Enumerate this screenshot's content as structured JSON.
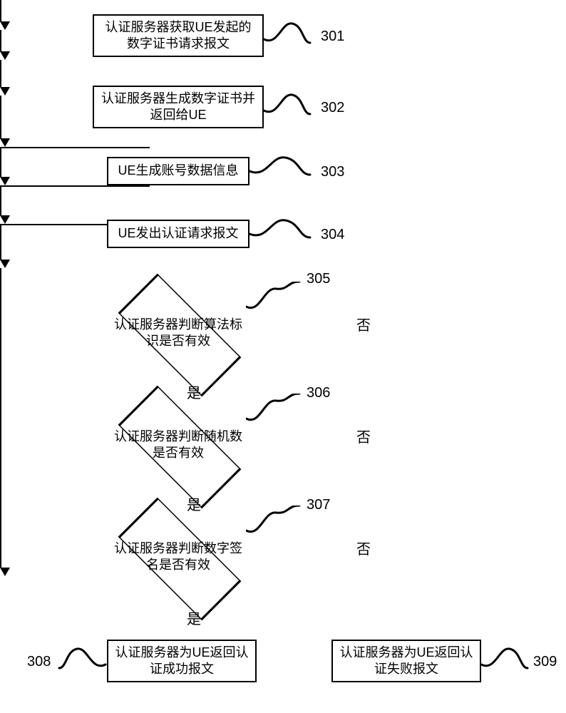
{
  "steps": {
    "s301": {
      "num": "301",
      "text": "认证服务器获取UE发起的数字证书请求报文"
    },
    "s302": {
      "num": "302",
      "text": "认证服务器生成数字证书并返回给UE"
    },
    "s303": {
      "num": "303",
      "text": "UE生成账号数据信息"
    },
    "s304": {
      "num": "304",
      "text": "UE发出认证请求报文"
    },
    "s305": {
      "num": "305",
      "text": "认证服务器判断算法标识是否有效"
    },
    "s306": {
      "num": "306",
      "text": "认证服务器判断随机数是否有效"
    },
    "s307": {
      "num": "307",
      "text": "认证服务器判断数字签名是否有效"
    },
    "s308": {
      "num": "308",
      "text": "认证服务器为UE返回认证成功报文"
    },
    "s309": {
      "num": "309",
      "text": "认证服务器为UE返回认证失败报文"
    }
  },
  "edges": {
    "yes": "是",
    "no": "否"
  }
}
